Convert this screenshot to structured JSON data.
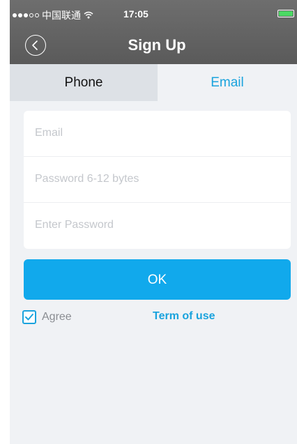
{
  "status_bar": {
    "carrier": "中国联通",
    "time": "17:05",
    "signal_dots_full": 3,
    "signal_dots_total": 5,
    "icons": [
      "signal-dots-icon",
      "wifi-icon",
      "battery-icon"
    ]
  },
  "nav": {
    "title": "Sign Up",
    "back_icon": "chevron-left-circle-icon"
  },
  "tabs": [
    {
      "label": "Phone",
      "active": false
    },
    {
      "label": "Email",
      "active": true
    }
  ],
  "form": {
    "email_placeholder": "Email",
    "password_placeholder": "Password 6-12 bytes",
    "confirm_placeholder": "Enter Password"
  },
  "ok_button": {
    "label": "OK"
  },
  "agree": {
    "label": "Agree",
    "checked": true,
    "term_link": "Term of use"
  },
  "colors": {
    "accent": "#11a9ec",
    "link": "#1aa3dd",
    "header": "#646464",
    "background": "#f0f2f5"
  }
}
